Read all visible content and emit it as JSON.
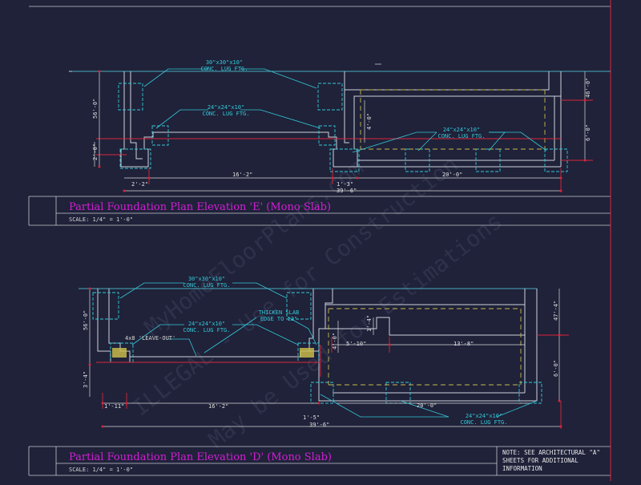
{
  "drawing_e": {
    "title": "Partial Foundation Plan Elevation 'E' (Mono Slab)",
    "scale": "SCALE: 1/4\" = 1'-0\"",
    "callout_30": [
      "30\"x30\"x10\"",
      "CONC. LUG FTG."
    ],
    "callout_24_left": [
      "24\"x24\"x10\"",
      "CONC. LUG FTG."
    ],
    "callout_24_right": [
      "24\"x24\"x10\"",
      "CONC. LUG FTG."
    ],
    "dims": {
      "left_56": "56'-0\"",
      "left_2": "2'-0\"",
      "bottom_2_2": "2'-2\"",
      "bottom_16_2": "16'-2\"",
      "bottom_1_3": "1'-3\"",
      "bottom_20": "20'-0\"",
      "bottom_39_6": "39'-6\"",
      "inner_4": "4'-0\"",
      "right_46": "46'-0\"",
      "right_6": "6'-0\""
    }
  },
  "drawing_d": {
    "title": "Partial Foundation Plan Elevation 'D' (Mono Slab)",
    "scale": "SCALE: 1/4\" = 1'-0\"",
    "callout_30": [
      "30\"x30\"x10\"",
      "CONC. LUG FTG."
    ],
    "callout_24_left": [
      "24\"x24\"x10\"",
      "CONC. LUG FTG."
    ],
    "callout_thicken": [
      "THICKEN SLAB",
      "EDGE TO 12\""
    ],
    "callout_leaveout": "4x8 'LEAVE-OUT'",
    "callout_24_bottom": [
      "24\"x24\"x10\"",
      "CONC. LUG FTG."
    ],
    "dims": {
      "left_56": "56'-0\"",
      "left_3_4": "3'-4\"",
      "bottom_1_11": "1'-11\"",
      "bottom_16_2": "16'-2\"",
      "bottom_1_5": "1'-5\"",
      "bottom_39_6": "39'-6\"",
      "bottom_20": "20'-0\"",
      "inner_1_4": "1'-4\"",
      "inner_4": "4'-0\"",
      "inner_5_10": "5'-10\"",
      "inner_13_8": "13'-8\"",
      "right_47_4": "47'-4\"",
      "right_6": "6'-0\""
    },
    "note": [
      "NOTE: SEE ARCHITECTURAL \"A\"",
      "SHEETS FOR ADDITIONAL",
      "INFORMATION"
    ]
  },
  "watermark": [
    "MyHomeFloorPlans.com",
    "ILLEGAL - Use for Construction",
    "May be Used for Estimations"
  ],
  "colors": {
    "background": "#1f2239",
    "wall": "#cfd3dc",
    "dim": "#d8d8d8",
    "footing": "#35c8d8",
    "slab": "#c8b84a",
    "red": "#d8263c",
    "magenta": "#d51dd6",
    "border": "#c9c9cf"
  }
}
